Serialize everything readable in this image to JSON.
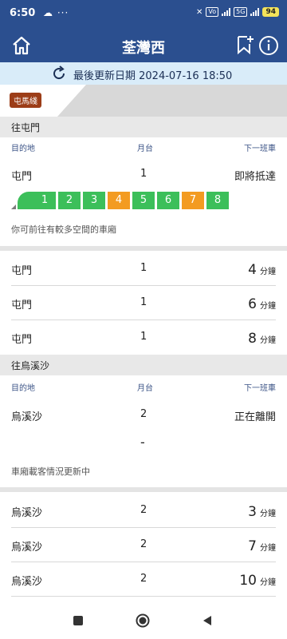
{
  "status_bar": {
    "time": "6:50",
    "left_icons": "☁ ···",
    "chips": [
      "Vo",
      "5G"
    ],
    "battery": "94"
  },
  "app_bar": {
    "title": "荃灣西"
  },
  "update": {
    "text": "最後更新日期 2024-07-16 18:50"
  },
  "line_badge": "屯馬綫",
  "column_headers": {
    "destination": "目的地",
    "platform": "月台",
    "next_train": "下一班車"
  },
  "section_tuen_mun": {
    "heading": "往屯門",
    "first": {
      "destination": "屯門",
      "platform": "1",
      "eta": "即將抵達"
    },
    "cars": [
      {
        "label": "1",
        "color": "#3cbf5a"
      },
      {
        "label": "2",
        "color": "#3cbf5a"
      },
      {
        "label": "3",
        "color": "#3cbf5a"
      },
      {
        "label": "4",
        "color": "#f39b21"
      },
      {
        "label": "5",
        "color": "#3cbf5a"
      },
      {
        "label": "6",
        "color": "#3cbf5a"
      },
      {
        "label": "7",
        "color": "#f39b21"
      },
      {
        "label": "8",
        "color": "#3cbf5a"
      }
    ],
    "note": "你可前往有較多空間的車廂",
    "rows": [
      {
        "destination": "屯門",
        "platform": "1",
        "eta_num": "4",
        "eta_unit": "分鐘"
      },
      {
        "destination": "屯門",
        "platform": "1",
        "eta_num": "6",
        "eta_unit": "分鐘"
      },
      {
        "destination": "屯門",
        "platform": "1",
        "eta_num": "8",
        "eta_unit": "分鐘"
      }
    ]
  },
  "section_wu_kai_sha": {
    "heading": "往烏溪沙",
    "first": {
      "destination": "烏溪沙",
      "platform": "2",
      "eta": "正在離開"
    },
    "dash": "-",
    "note": "車廂載客情況更新中",
    "rows": [
      {
        "destination": "烏溪沙",
        "platform": "2",
        "eta_num": "3",
        "eta_unit": "分鐘"
      },
      {
        "destination": "烏溪沙",
        "platform": "2",
        "eta_num": "7",
        "eta_unit": "分鐘"
      },
      {
        "destination": "烏溪沙",
        "platform": "2",
        "eta_num": "10",
        "eta_unit": "分鐘"
      }
    ]
  },
  "colors": {
    "header_blue": "#2b4f8f",
    "update_bg": "#d9ecf9",
    "line_badge": "#9c3d18",
    "car_green": "#3cbf5a",
    "car_orange": "#f39b21"
  }
}
